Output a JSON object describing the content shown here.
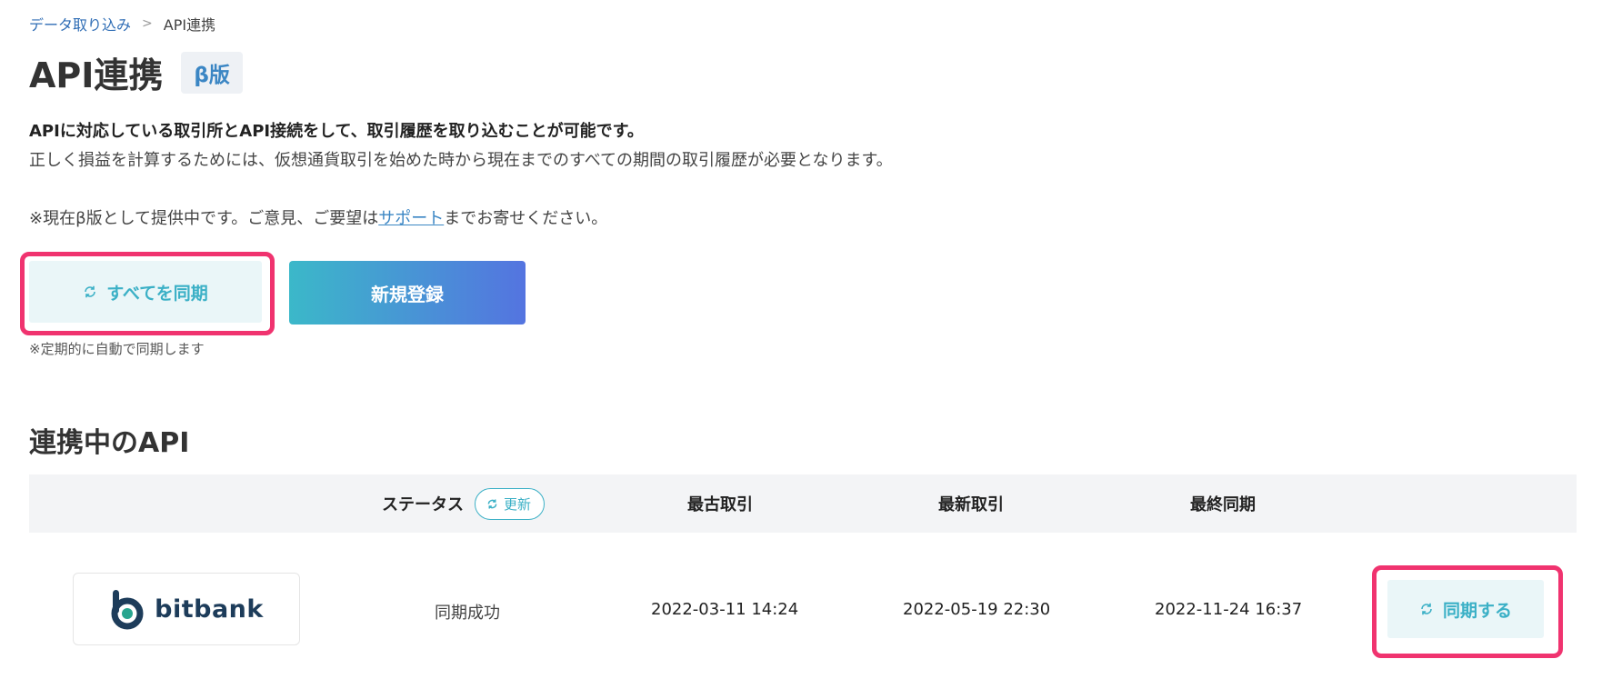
{
  "breadcrumb": {
    "parent": "データ取り込み",
    "separator": ">",
    "current": "API連携"
  },
  "page": {
    "title": "API連携",
    "badge": "β版"
  },
  "description": {
    "line1": "APIに対応している取引所とAPI接続をして、取引履歴を取り込むことが可能です。",
    "line2": "正しく損益を計算するためには、仮想通貨取引を始めた時から現在までのすべての期間の取引履歴が必要となります。",
    "notice_prefix": "※現在β版として提供中です。ご意見、ご要望は",
    "notice_link": "サポート",
    "notice_suffix": "までお寄せください。"
  },
  "actions": {
    "sync_all_label": "すべてを同期",
    "register_label": "新規登録",
    "auto_note": "※定期的に自動で同期します"
  },
  "connected": {
    "section_title": "連携中のAPI",
    "headers": {
      "status": "ステータス",
      "refresh": "更新",
      "oldest": "最古取引",
      "newest": "最新取引",
      "last_sync": "最終同期"
    },
    "rows": [
      {
        "exchange": "bitbank",
        "status": "同期成功",
        "oldest": "2022-03-11 14:24",
        "newest": "2022-05-19 22:30",
        "last_sync": "2022-11-24 16:37",
        "sync_label": "同期する"
      }
    ]
  },
  "icons": {
    "sync": "sync-icon",
    "logo": "bitbank-logo-icon"
  },
  "colors": {
    "accent": "#3bb0c6",
    "link": "#3b86c4",
    "highlight": "#f0336f",
    "gradient_start": "#3bb8c9",
    "gradient_end": "#5474e0",
    "logo": "#1d3c5a"
  }
}
